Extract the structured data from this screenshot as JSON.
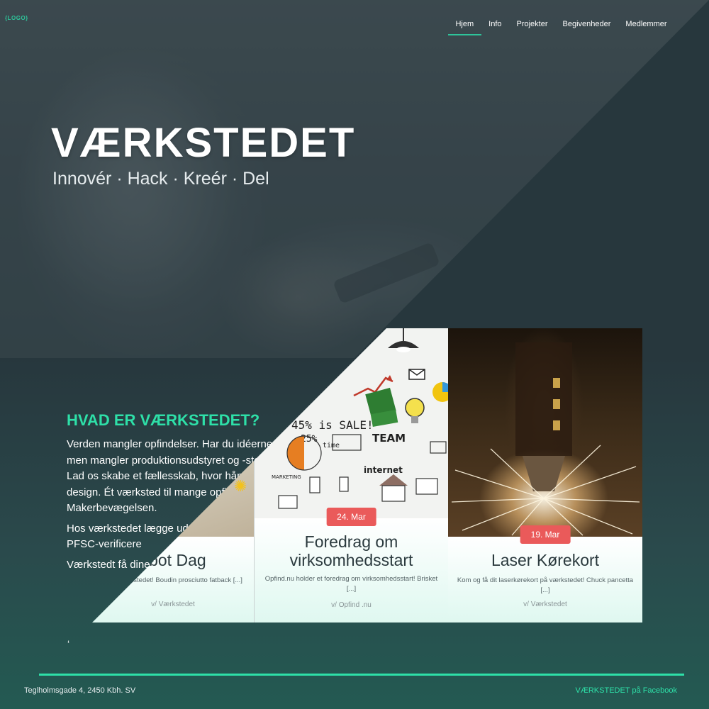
{
  "header": {
    "logo": "{LOGO}",
    "nav": [
      "Hjem",
      "Info",
      "Projekter",
      "Begivenheder",
      "Medlemmer"
    ],
    "active_nav": "Hjem"
  },
  "hero": {
    "title": "VÆRKSTEDET",
    "tagline": "Innovér · Hack · Kreér · Del"
  },
  "about": {
    "title": "HVAD ER VÆRKSTEDET?",
    "paragraphs": [
      "Verden mangler opfindelser. Har du idéerne men mangler produktionsudstyret og -stedet? Lad os skabe et fællesskab, hvor hån idéer og design. Ét værksted til mange opfinde Makerbevægelsen.",
      "Hos værkstedet lægge udnyttelse af reso PFSC-verificere",
      "Værkstedt få dine i"
    ],
    "stray_mark": "‘"
  },
  "events": [
    {
      "date": "",
      "title": "obot Dag",
      "excerpt": "med værkstedet! Boudin prosciutto fatback [...]",
      "author": "v/ Værkstedet"
    },
    {
      "date": "24. Mar",
      "title": "Foredrag om virksomhedsstart",
      "excerpt": "Opfind.nu holder et foredrag om virksomhedsstart! Brisket [...]",
      "author": "v/ Opfind .nu"
    },
    {
      "date": "19. Mar",
      "title": "Laser Kørekort",
      "excerpt": "Kom og få dit laserkørekort på værkstedet! Chuck pancetta [...]",
      "author": "v/ Værkstedet"
    }
  ],
  "sketch_words": {
    "sale": "45% is SALE!",
    "pct": "25%",
    "time": "time",
    "team": "TEAM",
    "marketing": "MARKETING",
    "internet": "internet"
  },
  "footer": {
    "address": "Teglholmsgade 4, 2450 Kbh. SV",
    "facebook": "VÆRKSTEDET på Facebook"
  },
  "colors": {
    "accent": "#2ee0a8",
    "date_badge": "#ea5a5a",
    "dark_bg": "#27373d"
  }
}
